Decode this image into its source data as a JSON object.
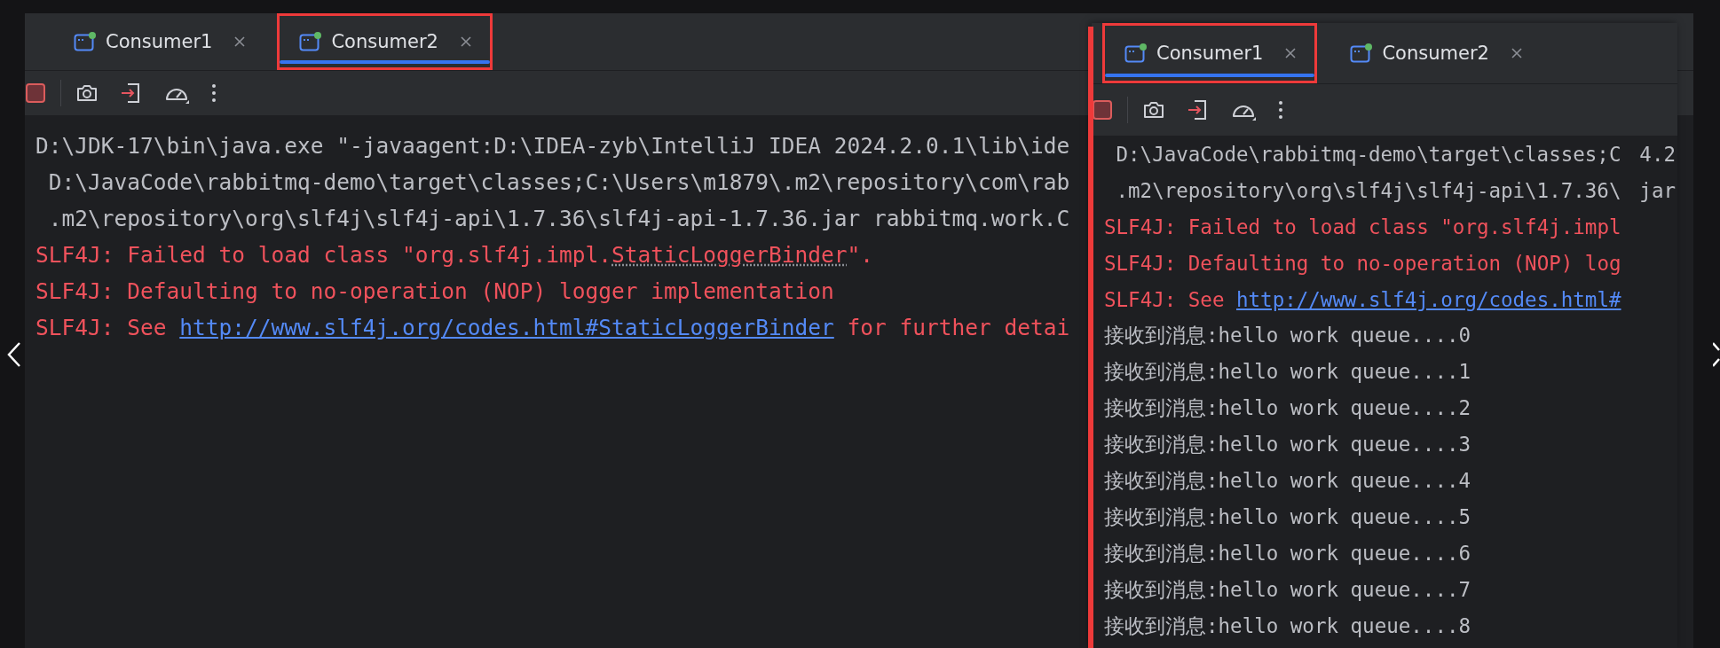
{
  "left_panel": {
    "tabs": [
      {
        "label": "Consumer1",
        "selected": false,
        "highlighted": false
      },
      {
        "label": "Consumer2",
        "selected": true,
        "highlighted": true
      }
    ],
    "console": [
      {
        "kind": "command",
        "parts": [
          {
            "text": "D:\\JDK-17\\bin\\java.exe \"-javaagent:D:\\IDEA-zyb\\IntelliJ IDEA 2024.2.0.1\\lib\\ide",
            "kind": "text"
          }
        ]
      },
      {
        "kind": "wrapped",
        "parts": [
          {
            "text": "D:\\JavaCode\\rabbitmq-demo\\target\\classes;C:\\Users\\m1879\\.m2\\repository\\com\\rab",
            "kind": "text"
          }
        ]
      },
      {
        "kind": "wrapped",
        "parts": [
          {
            "text": ".m2\\repository\\org\\slf4j\\slf4j-api\\1.7.36\\slf4j-api-1.7.36.jar rabbitmq.work.C",
            "kind": "text"
          }
        ]
      },
      {
        "kind": "error",
        "parts": [
          {
            "text": "SLF4J: Failed to load class \"org.slf4j.impl.",
            "kind": "text"
          },
          {
            "text": "StaticLoggerBinder",
            "kind": "dotted"
          },
          {
            "text": "\".",
            "kind": "text"
          }
        ]
      },
      {
        "kind": "error",
        "parts": [
          {
            "text": "SLF4J: Defaulting to no-operation (NOP) logger implementation",
            "kind": "text"
          }
        ]
      },
      {
        "kind": "error",
        "parts": [
          {
            "text": "SLF4J: See ",
            "kind": "text"
          },
          {
            "text": "http://www.slf4j.org/codes.html#StaticLoggerBinder",
            "kind": "link"
          },
          {
            "text": " for further detai",
            "kind": "text"
          }
        ]
      }
    ]
  },
  "right_panel": {
    "tabs": [
      {
        "label": "Consumer1",
        "selected": true,
        "highlighted": true
      },
      {
        "label": "Consumer2",
        "selected": false,
        "highlighted": false
      }
    ],
    "console": [
      {
        "kind": "wrapped",
        "parts": [
          {
            "text": "D:\\JavaCode\\rabbitmq-demo\\target\\classes;C",
            "kind": "text"
          }
        ],
        "tail": "4.2"
      },
      {
        "kind": "wrapped",
        "parts": [
          {
            "text": ".m2\\repository\\org\\slf4j\\slf4j-api\\1.7.36\\",
            "kind": "text"
          }
        ],
        "tail": "jar"
      },
      {
        "kind": "error",
        "parts": [
          {
            "text": "SLF4J: Failed to load class \"org.slf4j.impl",
            "kind": "text"
          }
        ]
      },
      {
        "kind": "error",
        "parts": [
          {
            "text": "SLF4J: Defaulting to no-operation (NOP) log",
            "kind": "text"
          }
        ]
      },
      {
        "kind": "error",
        "parts": [
          {
            "text": "SLF4J: See ",
            "kind": "text"
          },
          {
            "text": "http://www.slf4j.org/codes.html#",
            "kind": "link"
          }
        ]
      },
      {
        "kind": "output",
        "parts": [
          {
            "text": "接收到消息:hello work queue....0",
            "kind": "text"
          }
        ]
      },
      {
        "kind": "output",
        "parts": [
          {
            "text": "接收到消息:hello work queue....1",
            "kind": "text"
          }
        ]
      },
      {
        "kind": "output",
        "parts": [
          {
            "text": "接收到消息:hello work queue....2",
            "kind": "text"
          }
        ]
      },
      {
        "kind": "output",
        "parts": [
          {
            "text": "接收到消息:hello work queue....3",
            "kind": "text"
          }
        ]
      },
      {
        "kind": "output",
        "parts": [
          {
            "text": "接收到消息:hello work queue....4",
            "kind": "text"
          }
        ]
      },
      {
        "kind": "output",
        "parts": [
          {
            "text": "接收到消息:hello work queue....5",
            "kind": "text"
          }
        ]
      },
      {
        "kind": "output",
        "parts": [
          {
            "text": "接收到消息:hello work queue....6",
            "kind": "text"
          }
        ]
      },
      {
        "kind": "output",
        "parts": [
          {
            "text": "接收到消息:hello work queue....7",
            "kind": "text"
          }
        ]
      },
      {
        "kind": "output",
        "parts": [
          {
            "text": "接收到消息:hello work queue....8",
            "kind": "text"
          }
        ]
      }
    ]
  }
}
